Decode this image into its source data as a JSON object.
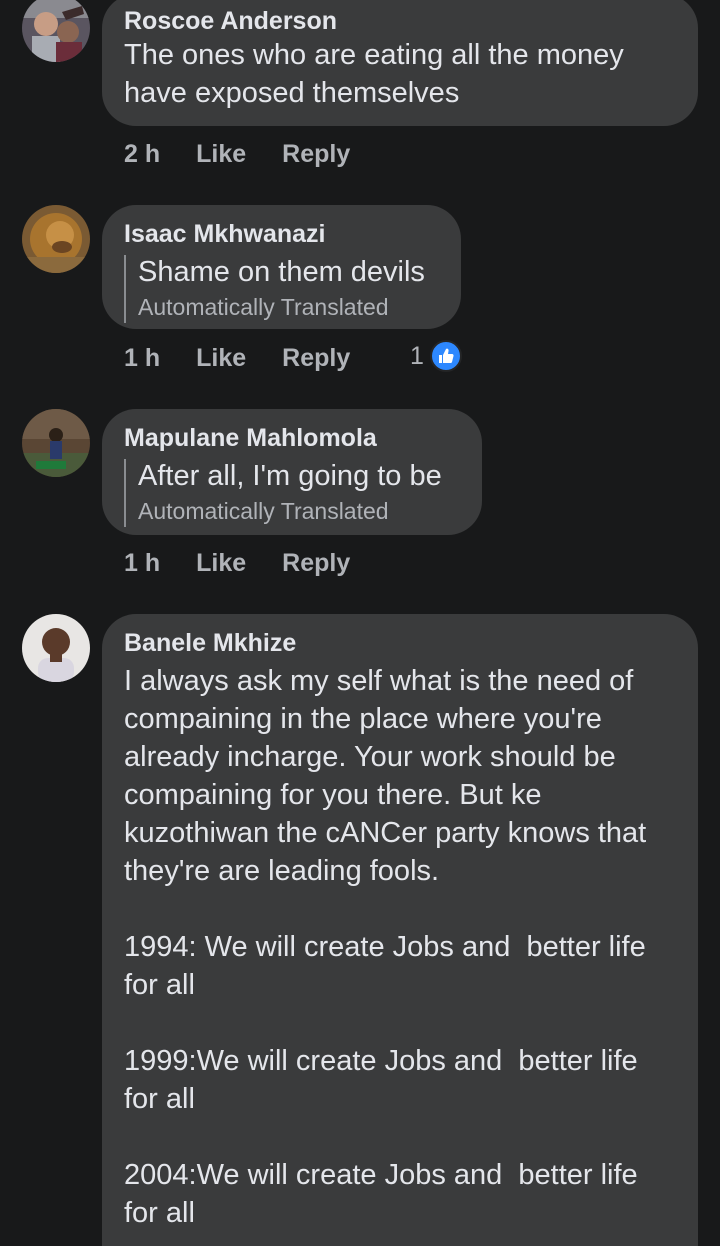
{
  "comments": [
    {
      "author": "Roscoe Anderson",
      "text": "The ones who are eating all the money\nhave exposed themselves",
      "time": "2 h",
      "like_label": "Like",
      "reply_label": "Reply"
    },
    {
      "author": "Isaac Mkhwanazi",
      "text": "Shame on them devils",
      "translated_note": "Automatically Translated",
      "time": "1 h",
      "like_label": "Like",
      "reply_label": "Reply",
      "reaction_count": "1",
      "reaction_icon": "thumbs-up-icon"
    },
    {
      "author": "Mapulane Mahlomola",
      "text": "After all, I'm going to be",
      "translated_note": "Automatically Translated",
      "time": "1 h",
      "like_label": "Like",
      "reply_label": "Reply"
    },
    {
      "author": "Banele Mkhize",
      "text": "I always ask my self what is the need of\ncompaining in the place where you're\nalready incharge. Your work should be\ncompaining for you there. But ke\nkuzothiwan the cANCer party knows that\nthey're are leading fools.\n\n1994: We will create Jobs and  better life\nfor all\n\n1999:We will create Jobs and  better life\nfor all\n\n2004:We will create Jobs and  better life\nfor all"
    }
  ],
  "colors": {
    "background": "#18191a",
    "bubble": "#3a3b3c",
    "primary_text": "#e4e6eb",
    "secondary_text": "#b0b3b8",
    "like_badge": "#2d88ff"
  }
}
